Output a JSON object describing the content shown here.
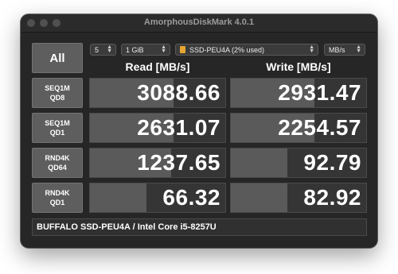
{
  "window": {
    "title": "AmorphousDiskMark 4.0.1"
  },
  "controls": {
    "all_label": "All",
    "test_count": "5",
    "test_size": "1 GiB",
    "drive": "SSD-PEU4A (2% used)",
    "unit": "MB/s"
  },
  "headers": {
    "read": "Read [MB/s]",
    "write": "Write [MB/s]"
  },
  "rows": [
    {
      "label_line1": "SEQ1M",
      "label_line2": "QD8",
      "read": "3088.66",
      "write": "2931.47",
      "read_fill": 0.62,
      "write_fill": 0.62
    },
    {
      "label_line1": "SEQ1M",
      "label_line2": "QD1",
      "read": "2631.07",
      "write": "2254.57",
      "read_fill": 0.62,
      "write_fill": 0.62
    },
    {
      "label_line1": "RND4K",
      "label_line2": "QD64",
      "read": "1237.65",
      "write": "92.79",
      "read_fill": 0.6,
      "write_fill": 0.42
    },
    {
      "label_line1": "RND4K",
      "label_line2": "QD1",
      "read": "66.32",
      "write": "82.92",
      "read_fill": 0.42,
      "write_fill": 0.42
    }
  ],
  "footer": {
    "text": "BUFFALO SSD-PEU4A / Intel Core i5-8257U"
  },
  "colors": {
    "window_bg": "#262626",
    "button_bg": "#5e5e5e",
    "bar_fill": "#5a5a5a",
    "drive_icon": "#e6a632"
  }
}
